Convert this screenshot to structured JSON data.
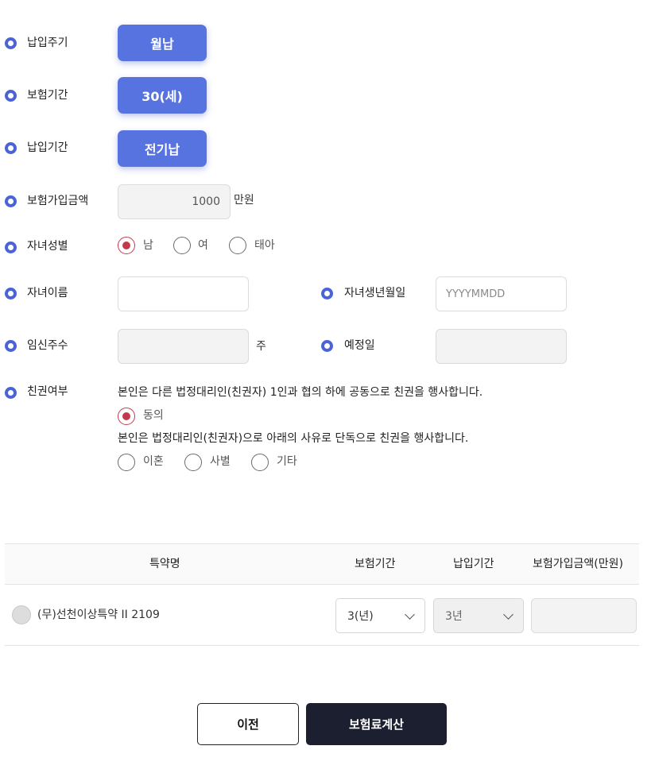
{
  "form": {
    "payment_cycle": {
      "label": "납입주기",
      "value": "월납"
    },
    "insurance_period": {
      "label": "보험기간",
      "value": "30(세)"
    },
    "payment_period": {
      "label": "납입기간",
      "value": "전기납"
    },
    "insured_amount": {
      "label": "보험가입금액",
      "value": "1000",
      "unit": "만원"
    },
    "child_gender": {
      "label": "자녀성별",
      "options": [
        "남",
        "여",
        "태아"
      ],
      "selected": "남"
    },
    "child_name": {
      "label": "자녀이름",
      "value": ""
    },
    "child_birth": {
      "label": "자녀생년월일",
      "placeholder": "YYYYMMDD"
    },
    "pregnancy_weeks": {
      "label": "임신주수",
      "value": "",
      "unit": "주"
    },
    "due_date": {
      "label": "예정일",
      "value": ""
    },
    "parental_authority": {
      "label": "친권여부",
      "sentence1": "본인은 다른 법정대리인(친권자) 1인과 협의 하에 공동으로 친권을 행사합니다.",
      "agree_label": "동의",
      "sentence2": "본인은 법정대리인(친권자)으로 아래의 사유로 단독으로 친권을 행사합니다.",
      "reasons": [
        "이혼",
        "사별",
        "기타"
      ]
    }
  },
  "table": {
    "headers": [
      "특약명",
      "보험기간",
      "납입기간",
      "보험가입금액(만원)"
    ],
    "rows": [
      {
        "name": "(무)선천이상특약 II  2109",
        "period": "3(년)",
        "pay_period": "3년",
        "amount": ""
      }
    ]
  },
  "buttons": {
    "prev": "이전",
    "calc": "보험료계산"
  },
  "colors": {
    "accent": "#5773e0",
    "radio_selected": "#c23a49",
    "primary_button": "#1b1f2f"
  }
}
